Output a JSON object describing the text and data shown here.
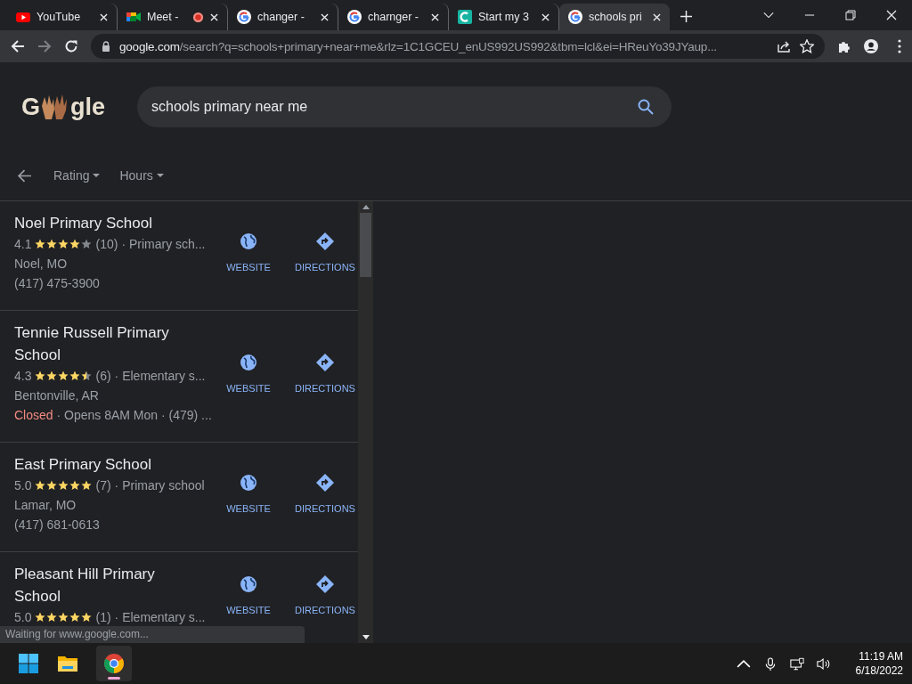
{
  "tabs": [
    {
      "title": "YouTube",
      "kind": "youtube",
      "recording": false,
      "selected": false
    },
    {
      "title": "Meet -",
      "kind": "meet",
      "recording": true,
      "selected": false
    },
    {
      "title": "changer -",
      "kind": "google",
      "recording": false,
      "selected": false
    },
    {
      "title": "charnger -",
      "kind": "google",
      "recording": false,
      "selected": false
    },
    {
      "title": "Start my 3",
      "kind": "c",
      "recording": false,
      "selected": false
    },
    {
      "title": "schools pri",
      "kind": "google",
      "recording": false,
      "selected": true
    }
  ],
  "address_bar": {
    "host": "google.com",
    "path": "/search?q=schools+primary+near+me&rlz=1C1GCEU_enUS992US992&tbm=lcl&ei=HReuYo39JYaup..."
  },
  "logo": {
    "left": "G",
    "right": "gle"
  },
  "search": {
    "value": "schools primary near me"
  },
  "filters": [
    {
      "label": "Rating"
    },
    {
      "label": "Hours"
    }
  ],
  "results": [
    {
      "name": "Noel Primary School",
      "rating": "4.1",
      "stars": 4,
      "reviews": "(10)",
      "category": "· Primary sch...",
      "lines": [
        {
          "text": "Noel, MO"
        },
        {
          "text": "(417) 475-3900"
        }
      ],
      "actions": [
        {
          "kind": "website",
          "label": "WEBSITE"
        },
        {
          "kind": "directions",
          "label": "DIRECTIONS"
        }
      ]
    },
    {
      "name": "Tennie Russell Primary School",
      "rating": "4.3",
      "stars": 4.5,
      "reviews": "(6)",
      "category": "· Elementary s...",
      "lines": [
        {
          "text": "Bentonville, AR"
        },
        {
          "alert": "Closed",
          "text": "· Opens 8AM Mon · (479) ..."
        }
      ],
      "actions": [
        {
          "kind": "website",
          "label": "WEBSITE"
        },
        {
          "kind": "directions",
          "label": "DIRECTIONS"
        }
      ]
    },
    {
      "name": "East Primary School",
      "rating": "5.0",
      "stars": 5,
      "reviews": "(7)",
      "category": "· Primary school",
      "lines": [
        {
          "text": "Lamar, MO"
        },
        {
          "text": "(417) 681-0613"
        }
      ],
      "actions": [
        {
          "kind": "website",
          "label": "WEBSITE"
        },
        {
          "kind": "directions",
          "label": "DIRECTIONS"
        }
      ]
    },
    {
      "name": "Pleasant Hill Primary School",
      "rating": "5.0",
      "stars": 5,
      "reviews": "(1)",
      "category": "· Elementary s...",
      "actions": [
        {
          "kind": "website",
          "label": "WEBSITE"
        },
        {
          "kind": "directions",
          "label": "DIRECTIONS"
        }
      ]
    }
  ],
  "status_bubble": "Waiting for www.google.com...",
  "taskbar": {
    "time": "11:19 AM",
    "date": "6/18/2022"
  }
}
